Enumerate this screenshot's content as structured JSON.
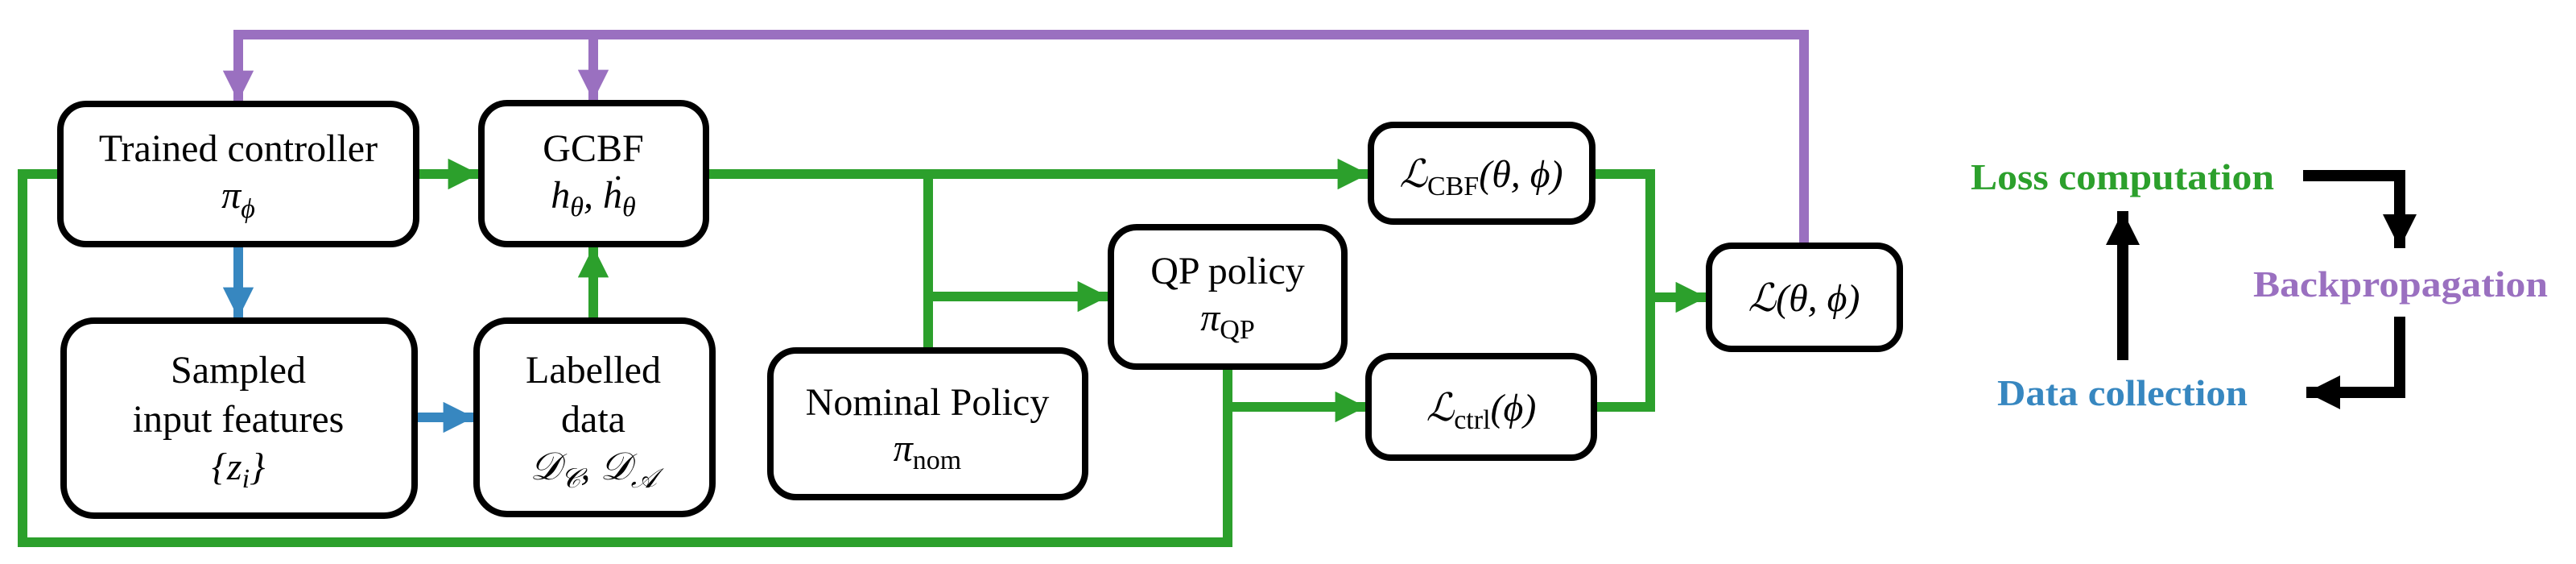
{
  "colors": {
    "forward": "#2ca02c",
    "backprop": "#9a70c0",
    "data": "#3787c0",
    "cycle_arrow": "#000000"
  },
  "nodes": {
    "trained_controller": {
      "title": "Trained controller",
      "symbol": "π",
      "symbol_sub": "ϕ"
    },
    "gcbf": {
      "title": "GCBF",
      "math": "h",
      "math_sub": "θ",
      "sep": ", ",
      "math2": "ḣ",
      "math2_sub": "θ"
    },
    "sampled": {
      "line1": "Sampled",
      "line2": "input features",
      "math": "{z",
      "math_sub": "i",
      "math_end": "}"
    },
    "labelled": {
      "line1": "Labelled",
      "line2": "data",
      "math": "𝒟",
      "math_sub": "𝒞",
      "sep": ", ",
      "math2": "𝒟",
      "math2_sub": "𝒜"
    },
    "nominal": {
      "title": "Nominal Policy",
      "symbol": "π",
      "symbol_sub": "nom"
    },
    "qp": {
      "title": "QP policy",
      "symbol": "π",
      "symbol_sub": "QP"
    },
    "loss_cbf": {
      "symbol": "ℒ",
      "sub": "CBF",
      "args": "(θ, ϕ)"
    },
    "loss_ctrl": {
      "symbol": "ℒ",
      "sub": "ctrl",
      "args": "(ϕ)"
    },
    "loss_total": {
      "symbol": "ℒ",
      "args": "(θ, ϕ)"
    }
  },
  "legend": {
    "loss": "Loss computation",
    "backprop": "Backpropagation",
    "data": "Data collection"
  }
}
